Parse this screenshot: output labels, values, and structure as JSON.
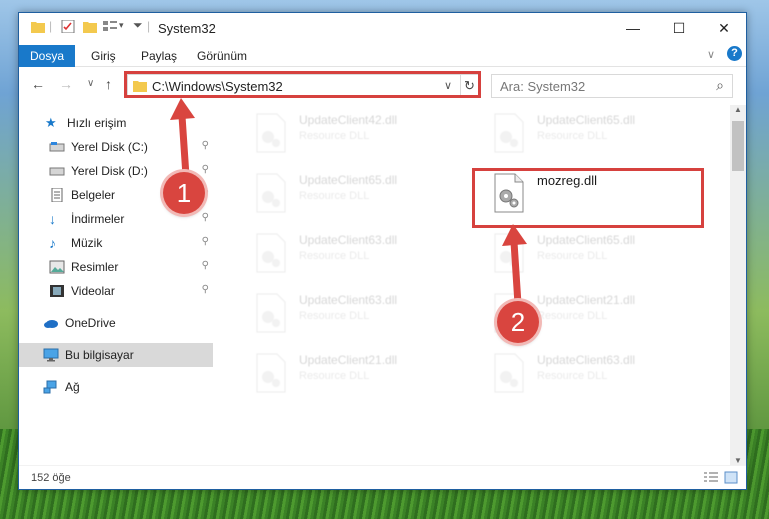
{
  "window": {
    "title": "System32",
    "controls": {
      "minimize": "—",
      "maximize": "☐",
      "close": "✕"
    }
  },
  "ribbon": {
    "tabs": [
      "Dosya",
      "Giriş",
      "Paylaş",
      "Görünüm"
    ],
    "expand_icon": "∨",
    "help_icon": "?"
  },
  "navigation": {
    "back": "←",
    "forward": "→",
    "recent": "∨",
    "up": "↑",
    "address": "C:\\Windows\\System32",
    "address_dropdown": "∨",
    "refresh": "↻",
    "search_placeholder": "Ara: System32",
    "search_icon": "⌕"
  },
  "sidebar": {
    "items": [
      {
        "label": "Hızlı erişim",
        "icon": "star-icon",
        "pinned": false
      },
      {
        "label": "Yerel Disk (C:)",
        "icon": "drive-icon",
        "pinned": true
      },
      {
        "label": "Yerel Disk (D:)",
        "icon": "drive-icon",
        "pinned": true
      },
      {
        "label": "Belgeler",
        "icon": "documents-icon",
        "pinned": true
      },
      {
        "label": "İndirmeler",
        "icon": "downloads-icon",
        "pinned": true
      },
      {
        "label": "Müzik",
        "icon": "music-icon",
        "pinned": true
      },
      {
        "label": "Resimler",
        "icon": "pictures-icon",
        "pinned": true
      },
      {
        "label": "Videolar",
        "icon": "videos-icon",
        "pinned": true
      },
      {
        "label": "OneDrive",
        "icon": "onedrive-icon",
        "pinned": false
      },
      {
        "label": "Bu bilgisayar",
        "icon": "computer-icon",
        "pinned": false
      },
      {
        "label": "Ağ",
        "icon": "network-icon",
        "pinned": false
      }
    ],
    "pin_glyph": "📌"
  },
  "files": [
    {
      "name": "UpdateClient42.dll",
      "type": "Resource DLL",
      "faded": true
    },
    {
      "name": "UpdateClient65.dll",
      "type": "Resource DLL",
      "faded": true
    },
    {
      "name": "UpdateClient65.dll",
      "type": "Resource DLL",
      "faded": true
    },
    {
      "name": "mozreg.dll",
      "type": "",
      "faded": false
    },
    {
      "name": "UpdateClient63.dll",
      "type": "Resource DLL",
      "faded": true
    },
    {
      "name": "UpdateClient65.dll",
      "type": "Resource DLL",
      "faded": true
    },
    {
      "name": "UpdateClient63.dll",
      "type": "Resource DLL",
      "faded": true
    },
    {
      "name": "UpdateClient21.dll",
      "type": "Resource DLL",
      "faded": true
    },
    {
      "name": "UpdateClient21.dll",
      "type": "Resource DLL",
      "faded": true
    },
    {
      "name": "UpdateClient63.dll",
      "type": "Resource DLL",
      "faded": true
    }
  ],
  "status": {
    "count": "152 öğe"
  },
  "annotations": {
    "step1": "1",
    "step2": "2",
    "color": "#d6413e"
  }
}
